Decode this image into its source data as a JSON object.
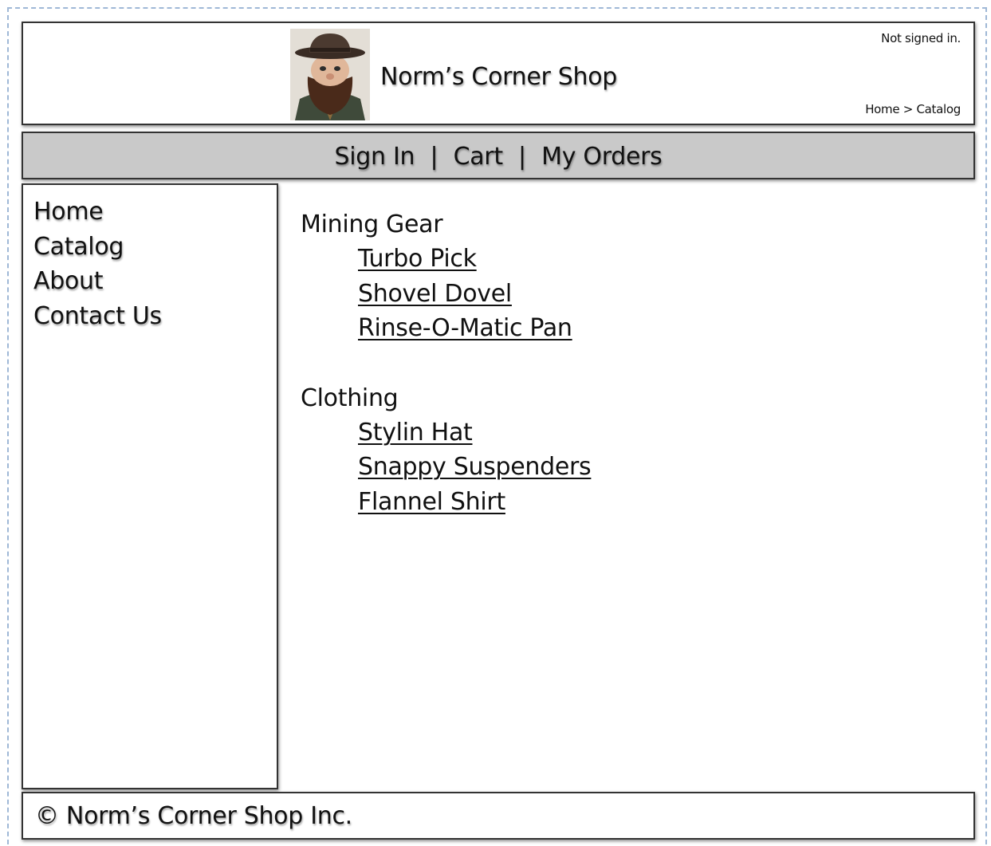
{
  "header": {
    "shop_name": "Norm’s Corner Shop",
    "signin_status": "Not signed in.",
    "breadcrumb": "Home > Catalog"
  },
  "nav": {
    "items": [
      {
        "label": "Sign In"
      },
      {
        "label": "Cart"
      },
      {
        "label": "My Orders"
      }
    ],
    "separator": "|"
  },
  "sidebar": {
    "items": [
      {
        "label": "Home"
      },
      {
        "label": "Catalog"
      },
      {
        "label": "About"
      },
      {
        "label": "Contact Us"
      }
    ]
  },
  "catalog": {
    "categories": [
      {
        "name": "Mining Gear",
        "products": [
          "Turbo Pick",
          "Shovel Dovel",
          "Rinse-O-Matic Pan"
        ]
      },
      {
        "name": "Clothing",
        "products": [
          "Stylin Hat",
          "Snappy Suspenders",
          "Flannel Shirt"
        ]
      }
    ]
  },
  "footer": {
    "copyright": "© Norm’s Corner Shop Inc."
  },
  "colors": {
    "nav_background": "#c9c9c9",
    "frame_border": "#9fb8d6",
    "box_border": "#333333"
  }
}
